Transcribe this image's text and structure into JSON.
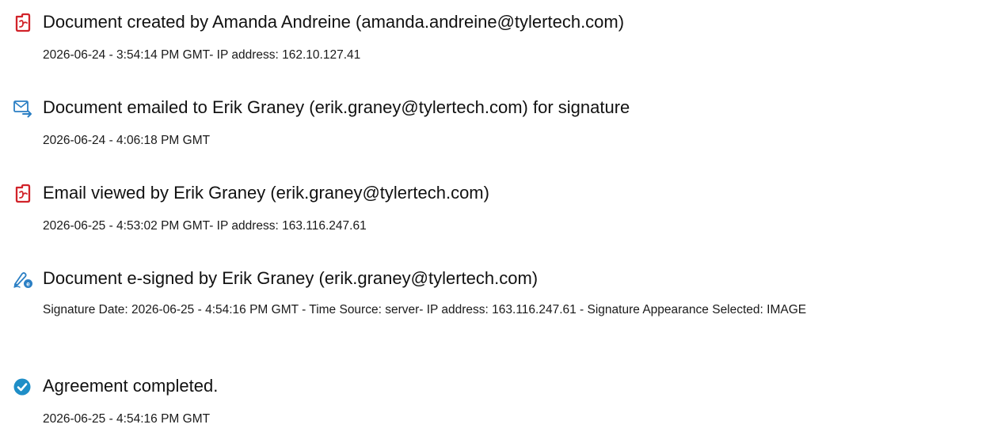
{
  "colors": {
    "pdf_icon": "#d1232a",
    "email_icon": "#2b7fc4",
    "esign_icon": "#2b7fc4",
    "complete_icon": "#1f8ec7",
    "text": "#111111"
  },
  "events": [
    {
      "icon": "pdf-document-icon",
      "title": "Document created by Amanda Andreine (amanda.andreine@tylertech.com)",
      "detail": "2026-06-24 - 3:54:14 PM GMT- IP address: 162.10.127.41"
    },
    {
      "icon": "email-send-icon",
      "title": "Document emailed to Erik Graney (erik.graney@tylertech.com) for signature",
      "detail": "2026-06-24 - 4:06:18 PM GMT"
    },
    {
      "icon": "pdf-document-icon",
      "title": "Email viewed by Erik Graney (erik.graney@tylertech.com)",
      "detail": "2026-06-25 - 4:53:02 PM GMT- IP address: 163.116.247.61"
    },
    {
      "icon": "e-sign-pen-icon",
      "title": "Document e-signed by Erik Graney (erik.graney@tylertech.com)",
      "detail": "Signature Date: 2026-06-25 - 4:54:16 PM GMT - Time Source: server- IP address: 163.116.247.61 - Signature Appearance Selected: IMAGE"
    },
    {
      "icon": "check-circle-icon",
      "title": "Agreement completed.",
      "detail": "2026-06-25 - 4:54:16 PM GMT"
    }
  ]
}
